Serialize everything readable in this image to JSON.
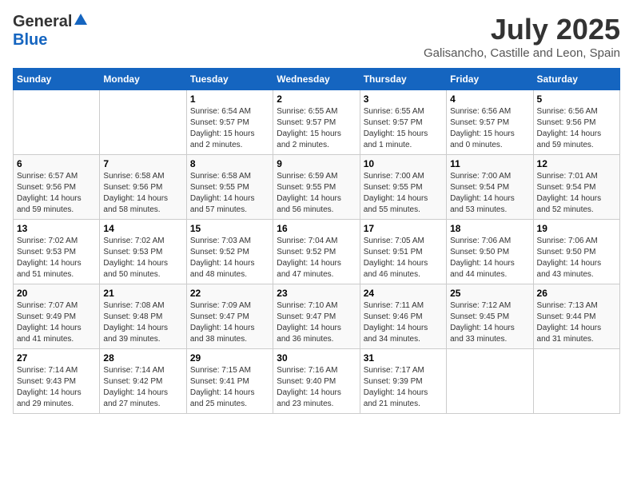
{
  "header": {
    "logo_general": "General",
    "logo_blue": "Blue",
    "title": "July 2025",
    "location": "Galisancho, Castille and Leon, Spain"
  },
  "calendar": {
    "days_of_week": [
      "Sunday",
      "Monday",
      "Tuesday",
      "Wednesday",
      "Thursday",
      "Friday",
      "Saturday"
    ],
    "weeks": [
      [
        {
          "day": "",
          "info": ""
        },
        {
          "day": "",
          "info": ""
        },
        {
          "day": "1",
          "info": "Sunrise: 6:54 AM\nSunset: 9:57 PM\nDaylight: 15 hours and 2 minutes."
        },
        {
          "day": "2",
          "info": "Sunrise: 6:55 AM\nSunset: 9:57 PM\nDaylight: 15 hours and 2 minutes."
        },
        {
          "day": "3",
          "info": "Sunrise: 6:55 AM\nSunset: 9:57 PM\nDaylight: 15 hours and 1 minute."
        },
        {
          "day": "4",
          "info": "Sunrise: 6:56 AM\nSunset: 9:57 PM\nDaylight: 15 hours and 0 minutes."
        },
        {
          "day": "5",
          "info": "Sunrise: 6:56 AM\nSunset: 9:56 PM\nDaylight: 14 hours and 59 minutes."
        }
      ],
      [
        {
          "day": "6",
          "info": "Sunrise: 6:57 AM\nSunset: 9:56 PM\nDaylight: 14 hours and 59 minutes."
        },
        {
          "day": "7",
          "info": "Sunrise: 6:58 AM\nSunset: 9:56 PM\nDaylight: 14 hours and 58 minutes."
        },
        {
          "day": "8",
          "info": "Sunrise: 6:58 AM\nSunset: 9:55 PM\nDaylight: 14 hours and 57 minutes."
        },
        {
          "day": "9",
          "info": "Sunrise: 6:59 AM\nSunset: 9:55 PM\nDaylight: 14 hours and 56 minutes."
        },
        {
          "day": "10",
          "info": "Sunrise: 7:00 AM\nSunset: 9:55 PM\nDaylight: 14 hours and 55 minutes."
        },
        {
          "day": "11",
          "info": "Sunrise: 7:00 AM\nSunset: 9:54 PM\nDaylight: 14 hours and 53 minutes."
        },
        {
          "day": "12",
          "info": "Sunrise: 7:01 AM\nSunset: 9:54 PM\nDaylight: 14 hours and 52 minutes."
        }
      ],
      [
        {
          "day": "13",
          "info": "Sunrise: 7:02 AM\nSunset: 9:53 PM\nDaylight: 14 hours and 51 minutes."
        },
        {
          "day": "14",
          "info": "Sunrise: 7:02 AM\nSunset: 9:53 PM\nDaylight: 14 hours and 50 minutes."
        },
        {
          "day": "15",
          "info": "Sunrise: 7:03 AM\nSunset: 9:52 PM\nDaylight: 14 hours and 48 minutes."
        },
        {
          "day": "16",
          "info": "Sunrise: 7:04 AM\nSunset: 9:52 PM\nDaylight: 14 hours and 47 minutes."
        },
        {
          "day": "17",
          "info": "Sunrise: 7:05 AM\nSunset: 9:51 PM\nDaylight: 14 hours and 46 minutes."
        },
        {
          "day": "18",
          "info": "Sunrise: 7:06 AM\nSunset: 9:50 PM\nDaylight: 14 hours and 44 minutes."
        },
        {
          "day": "19",
          "info": "Sunrise: 7:06 AM\nSunset: 9:50 PM\nDaylight: 14 hours and 43 minutes."
        }
      ],
      [
        {
          "day": "20",
          "info": "Sunrise: 7:07 AM\nSunset: 9:49 PM\nDaylight: 14 hours and 41 minutes."
        },
        {
          "day": "21",
          "info": "Sunrise: 7:08 AM\nSunset: 9:48 PM\nDaylight: 14 hours and 39 minutes."
        },
        {
          "day": "22",
          "info": "Sunrise: 7:09 AM\nSunset: 9:47 PM\nDaylight: 14 hours and 38 minutes."
        },
        {
          "day": "23",
          "info": "Sunrise: 7:10 AM\nSunset: 9:47 PM\nDaylight: 14 hours and 36 minutes."
        },
        {
          "day": "24",
          "info": "Sunrise: 7:11 AM\nSunset: 9:46 PM\nDaylight: 14 hours and 34 minutes."
        },
        {
          "day": "25",
          "info": "Sunrise: 7:12 AM\nSunset: 9:45 PM\nDaylight: 14 hours and 33 minutes."
        },
        {
          "day": "26",
          "info": "Sunrise: 7:13 AM\nSunset: 9:44 PM\nDaylight: 14 hours and 31 minutes."
        }
      ],
      [
        {
          "day": "27",
          "info": "Sunrise: 7:14 AM\nSunset: 9:43 PM\nDaylight: 14 hours and 29 minutes."
        },
        {
          "day": "28",
          "info": "Sunrise: 7:14 AM\nSunset: 9:42 PM\nDaylight: 14 hours and 27 minutes."
        },
        {
          "day": "29",
          "info": "Sunrise: 7:15 AM\nSunset: 9:41 PM\nDaylight: 14 hours and 25 minutes."
        },
        {
          "day": "30",
          "info": "Sunrise: 7:16 AM\nSunset: 9:40 PM\nDaylight: 14 hours and 23 minutes."
        },
        {
          "day": "31",
          "info": "Sunrise: 7:17 AM\nSunset: 9:39 PM\nDaylight: 14 hours and 21 minutes."
        },
        {
          "day": "",
          "info": ""
        },
        {
          "day": "",
          "info": ""
        }
      ]
    ]
  }
}
